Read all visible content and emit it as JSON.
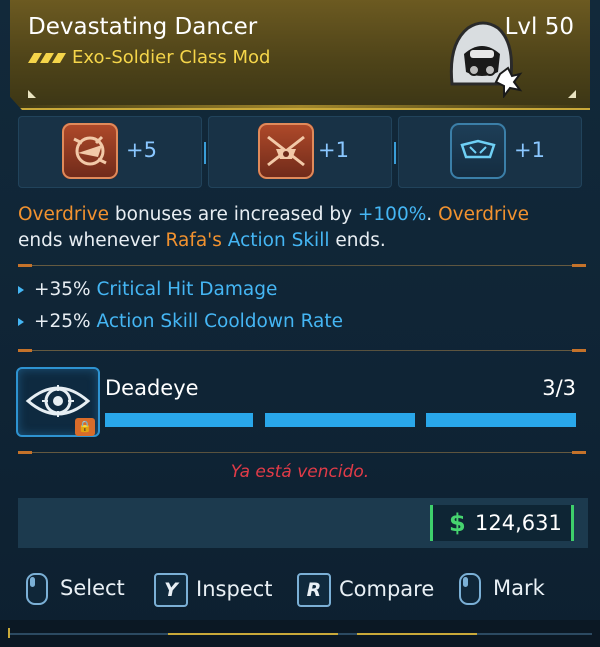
{
  "item": {
    "name": "Devastating Dancer",
    "level": "Lvl 50",
    "type": "Exo-Soldier Class Mod",
    "rarity_color": "#f5d54a"
  },
  "skills": [
    {
      "icon": "skill-burst-icon",
      "value": "+5"
    },
    {
      "icon": "skill-drone-icon",
      "value": "+1"
    },
    {
      "icon": "skill-shield-icon",
      "value": "+1"
    }
  ],
  "description": {
    "p1": "Overdrive",
    "p2": " bonuses are increased by ",
    "p3": "+100%",
    "p4": ". ",
    "p5": "Overdrive",
    "p6": "ends whenever ",
    "p7": "Rafa's",
    "p8": " ",
    "p9": "Action Skill",
    "p10": " ends."
  },
  "stats": [
    {
      "value": "+35%",
      "label": "Critical Hit Damage"
    },
    {
      "value": "+25%",
      "label": "Action Skill Cooldown Rate"
    }
  ],
  "passive": {
    "name": "Deadeye",
    "count": "3/3",
    "filled": 3,
    "total": 3
  },
  "warning": "Ya está vencido.",
  "price": {
    "currency": "$",
    "value": "124,631"
  },
  "footer": {
    "select": "Select",
    "inspect_key": "Y",
    "inspect": "Inspect",
    "compare_key": "R",
    "compare": "Compare",
    "mark": "Mark"
  }
}
